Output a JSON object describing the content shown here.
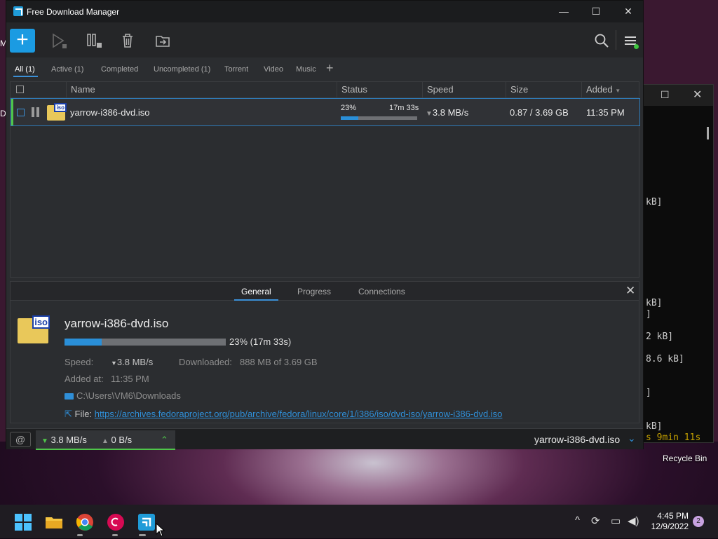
{
  "desktop": {
    "stray_m": "M",
    "stray_d": "D",
    "recycle_bin": "Recycle Bin"
  },
  "terminal": {
    "lines": [
      "kB]",
      "kB]",
      "]",
      "2 kB]",
      "8.6 kB]",
      "]",
      "kB]",
      "s 9min 11s"
    ]
  },
  "window": {
    "title": "Free Download Manager"
  },
  "toolbar": {
    "add": "+"
  },
  "filters": {
    "tabs": [
      "All (1)",
      "Active (1)",
      "Completed",
      "Uncompleted (1)",
      "Torrent",
      "Video",
      "Music"
    ],
    "add": "+"
  },
  "table": {
    "headers": [
      "Name",
      "Status",
      "Speed",
      "Size",
      "Added"
    ],
    "rows": [
      {
        "name": "yarrow-i386-dvd.iso",
        "status_percent": "23%",
        "status_time": "17m 33s",
        "progress": 0.23,
        "speed": "3.8 MB/s",
        "size": "0.87 / 3.69 GB",
        "added": "11:35 PM"
      }
    ]
  },
  "details": {
    "tabs": [
      "General",
      "Progress",
      "Connections"
    ],
    "file_name": "yarrow-i386-dvd.iso",
    "progress": 0.23,
    "progress_text": "23% (17m 33s)",
    "speed_label": "Speed:",
    "speed_value": "3.8 MB/s",
    "downloaded_label": "Downloaded:",
    "downloaded_value": "888 MB of 3.69 GB",
    "added_label": "Added at:",
    "added_value": "11:35 PM",
    "folder": "C:\\Users\\VM6\\Downloads",
    "file_label": "File:",
    "url": "https://archives.fedoraproject.org/pub/archive/fedora/linux/core/1/i386/iso/dvd-iso/yarrow-i386-dvd.iso"
  },
  "statusbar": {
    "download_speed": "3.8 MB/s",
    "upload_speed": "0 B/s",
    "current_file": "yarrow-i386-dvd.iso"
  },
  "taskbar": {
    "time": "4:45 PM",
    "date": "12/9/2022",
    "notifications": "2"
  },
  "colors": {
    "accent": "#1b9be2",
    "active_green": "#4fc64a",
    "window_bg": "#2b2d30"
  }
}
